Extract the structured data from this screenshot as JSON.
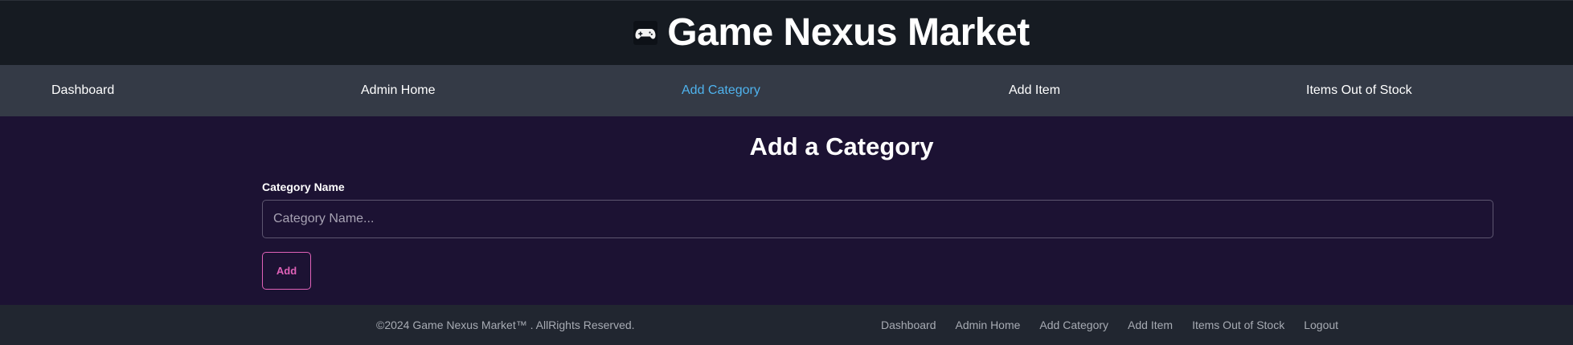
{
  "header": {
    "brand_icon": "gamepad-icon",
    "title": "Game Nexus Market"
  },
  "top_nav": {
    "items": [
      {
        "label": "Dashboard",
        "active": false
      },
      {
        "label": "Admin Home",
        "active": false
      },
      {
        "label": "Add Category",
        "active": true
      },
      {
        "label": "Add Item",
        "active": false
      },
      {
        "label": "Items Out of Stock",
        "active": false
      }
    ],
    "active_color": "#4fb3ee"
  },
  "main": {
    "title": "Add a Category",
    "field_label": "Category Name",
    "field_value": "",
    "field_placeholder": "Category Name...",
    "submit_label": "Add",
    "accent_color": "#e062b8"
  },
  "footer": {
    "copyright": "©2024 Game Nexus Market™ . AllRights Reserved.",
    "links": [
      "Dashboard",
      "Admin Home",
      "Add Category",
      "Add Item",
      "Items Out of Stock",
      "Logout"
    ]
  }
}
